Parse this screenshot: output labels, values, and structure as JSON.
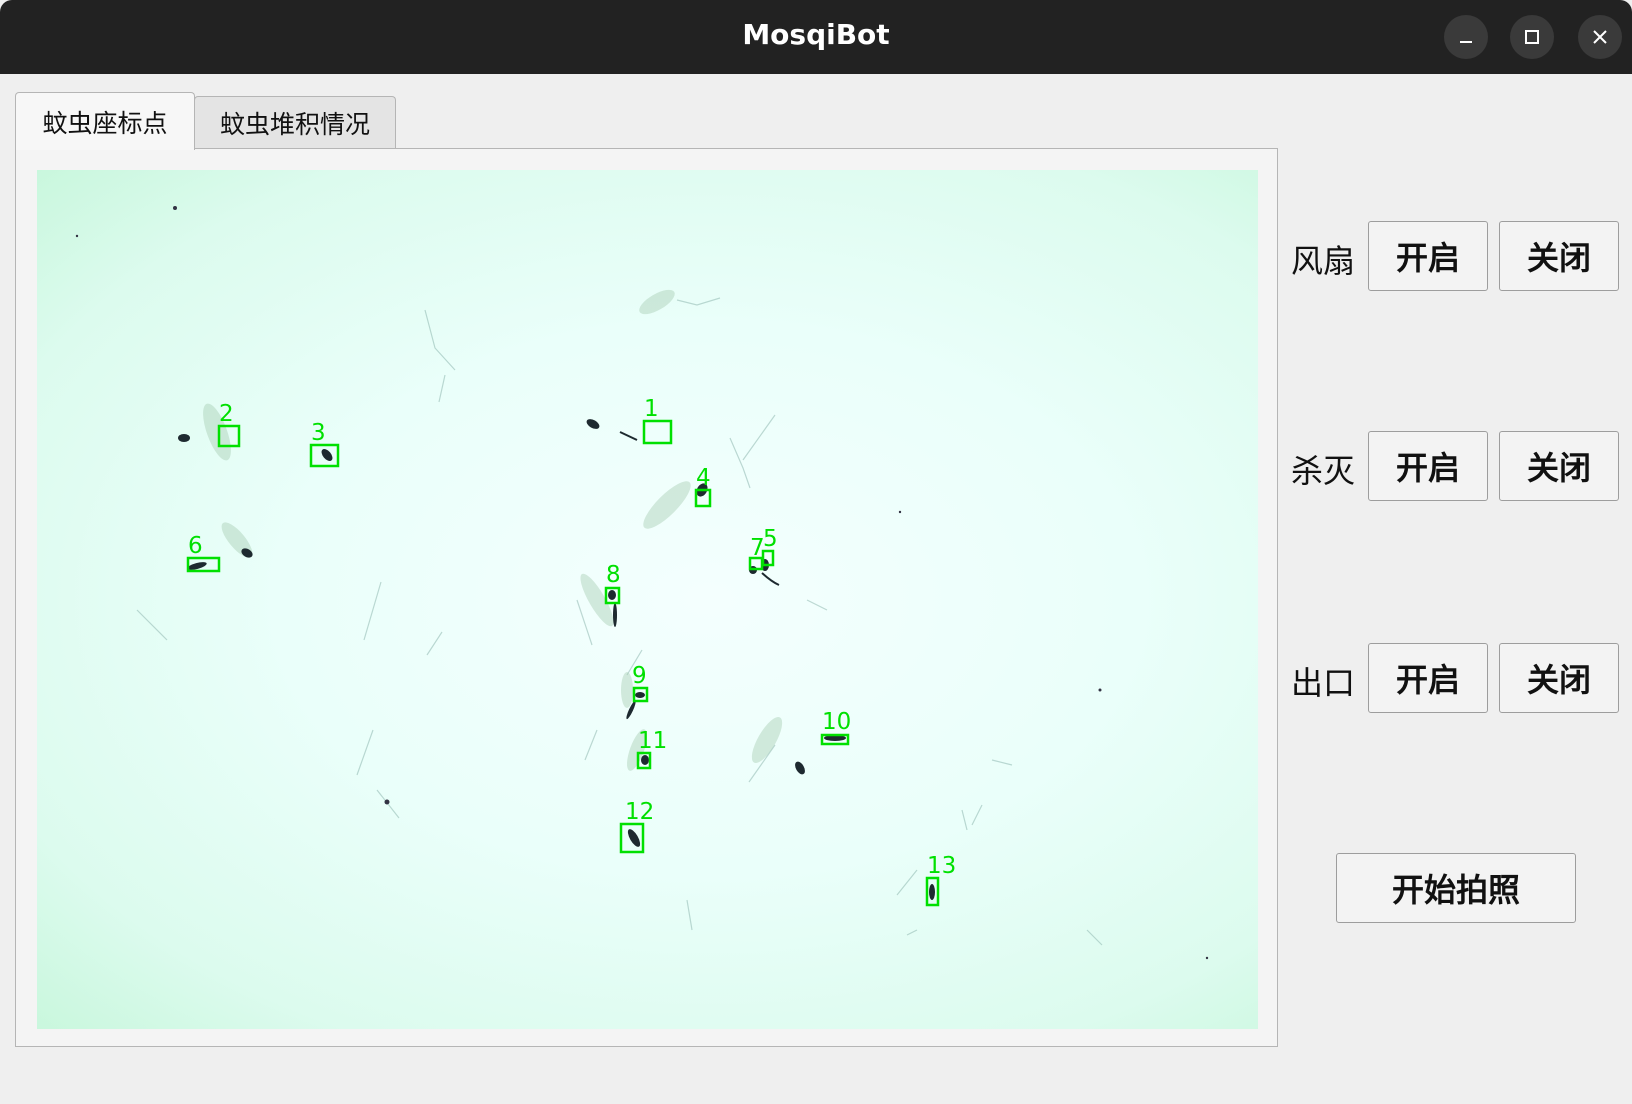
{
  "window": {
    "title": "MosqiBot",
    "controls": [
      "minimize-icon",
      "maximize-icon",
      "close-icon"
    ]
  },
  "tabs": [
    {
      "label": "蚊虫座标点",
      "active": true
    },
    {
      "label": "蚊虫堆积情况",
      "active": false
    }
  ],
  "detections": [
    {
      "id": "1"
    },
    {
      "id": "2"
    },
    {
      "id": "3"
    },
    {
      "id": "4"
    },
    {
      "id": "5"
    },
    {
      "id": "6"
    },
    {
      "id": "7"
    },
    {
      "id": "8"
    },
    {
      "id": "9"
    },
    {
      "id": "10"
    },
    {
      "id": "11"
    },
    {
      "id": "12"
    },
    {
      "id": "13"
    }
  ],
  "controls": {
    "fan": {
      "label": "风扇",
      "open": "开启",
      "close": "关闭"
    },
    "kill": {
      "label": "杀灭",
      "open": "开启",
      "close": "关闭"
    },
    "exit": {
      "label": "出口",
      "open": "开启",
      "close": "关闭"
    },
    "capture": "开始拍照"
  },
  "colors": {
    "titlebar": "#222222",
    "detection_box": "#00e000",
    "photo_background": "#eafffa"
  }
}
